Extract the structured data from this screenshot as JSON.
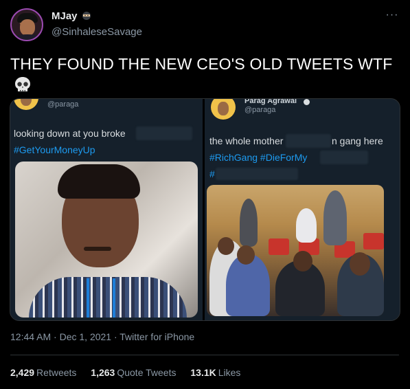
{
  "user": {
    "display_name": "MJay",
    "handle": "@SinhaleseSavage",
    "badge_icon": "ninja-emoji-icon"
  },
  "tweet": {
    "text": "THEY FOUND THE NEW CEO'S OLD TWEETS WTF",
    "emoji": [
      "skull-icon",
      "skull-icon"
    ]
  },
  "media": {
    "left": {
      "handle": "@paraga",
      "text": "looking down at you broke",
      "hashtag": "#GetYourMoneyUp"
    },
    "right": {
      "name": "Parag Agrawal",
      "handle": "@paraga",
      "text_before": "the whole mother",
      "text_after": "n gang here",
      "hashtags": "#RichGang #DieForMy",
      "hash_fragment": "#"
    }
  },
  "meta": {
    "time": "12:44 AM",
    "date": "Dec 1, 2021",
    "source": "Twitter for iPhone",
    "line": "12:44 AM · Dec 1, 2021 · Twitter for iPhone"
  },
  "stats": {
    "retweets": {
      "count": "2,429",
      "label": "Retweets"
    },
    "quotes": {
      "count": "1,263",
      "label": "Quote Tweets"
    },
    "likes": {
      "count": "13.1K",
      "label": "Likes"
    }
  },
  "colors": {
    "background": "#000000",
    "text": "#e7e9ea",
    "secondary": "#8b98a5",
    "link": "#1d9bf0",
    "border": "#2f3336"
  }
}
